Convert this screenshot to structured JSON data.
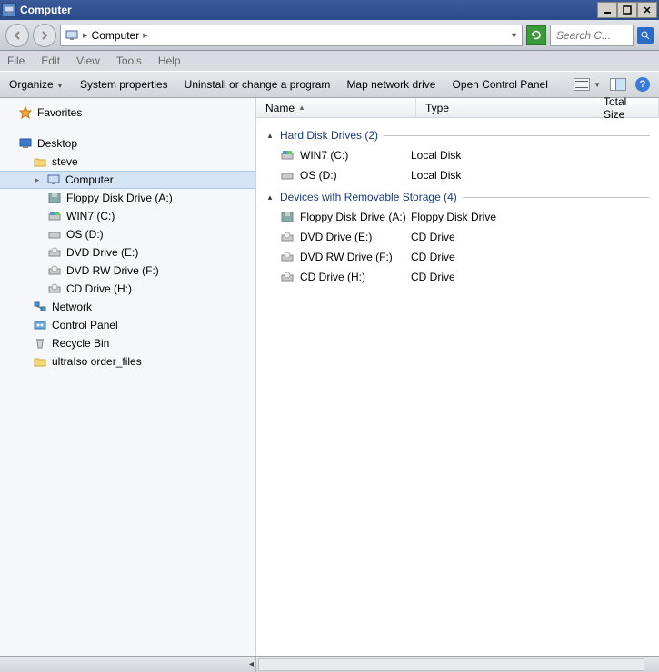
{
  "window": {
    "title": "Computer"
  },
  "address": {
    "segment": "Computer"
  },
  "search": {
    "placeholder": "Search C..."
  },
  "menu": {
    "file": "File",
    "edit": "Edit",
    "view": "View",
    "tools": "Tools",
    "help": "Help"
  },
  "toolbar": {
    "organize": "Organize",
    "sysprops": "System properties",
    "uninstall": "Uninstall or change a program",
    "mapdrive": "Map network drive",
    "controlpanel": "Open Control Panel"
  },
  "tree": {
    "favorites": "Favorites",
    "desktop": "Desktop",
    "user": "steve",
    "computer": "Computer",
    "drives": [
      "Floppy Disk Drive (A:)",
      "WIN7 (C:)",
      "OS (D:)",
      "DVD Drive (E:)",
      "DVD RW Drive (F:)",
      "CD Drive (H:)"
    ],
    "network": "Network",
    "controlpanel": "Control Panel",
    "recyclebin": "Recycle Bin",
    "folder": "ultraIso order_files"
  },
  "columns": {
    "name": "Name",
    "type": "Type",
    "totalsize": "Total Size"
  },
  "groups": {
    "hdd": {
      "label": "Hard Disk Drives (2)"
    },
    "removable": {
      "label": "Devices with Removable Storage (4)"
    }
  },
  "rows": {
    "hdd": [
      {
        "name": "WIN7 (C:)",
        "type": "Local Disk"
      },
      {
        "name": "OS (D:)",
        "type": "Local Disk"
      }
    ],
    "removable": [
      {
        "name": "Floppy Disk Drive (A:)",
        "type": "Floppy Disk Drive"
      },
      {
        "name": "DVD Drive (E:)",
        "type": "CD Drive"
      },
      {
        "name": "DVD RW Drive (F:)",
        "type": "CD Drive"
      },
      {
        "name": "CD Drive (H:)",
        "type": "CD Drive"
      }
    ]
  }
}
